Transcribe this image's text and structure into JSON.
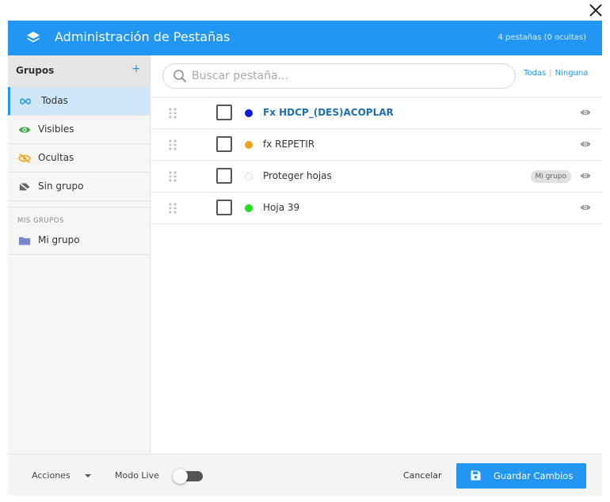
{
  "header": {
    "title": "Administración de Pestañas",
    "count": "4 pestañas (0 ocultas)"
  },
  "sidebar": {
    "heading": "Grupos",
    "add_label": "+",
    "items": [
      {
        "label": "Todas",
        "icon": "infinity-icon",
        "active": true
      },
      {
        "label": "Visibles",
        "icon": "eye-icon"
      },
      {
        "label": "Ocultas",
        "icon": "eye-off-icon"
      },
      {
        "label": "Sin grupo",
        "icon": "no-tag-icon"
      }
    ],
    "section_title": "MIS GRUPOS",
    "groups": [
      {
        "label": "Mi grupo",
        "icon": "folder-icon"
      }
    ]
  },
  "search": {
    "placeholder": "Buscar pestaña...",
    "value": ""
  },
  "filters": {
    "all_label": "Todas",
    "none_label": "Ninguna"
  },
  "tabs": [
    {
      "name": "Fx HDCP_(DES)ACOPLAR",
      "color": "#0b1bdc",
      "active": true,
      "group": ""
    },
    {
      "name": "fx REPETIR",
      "color": "#f0a020",
      "active": false,
      "group": ""
    },
    {
      "name": "Proteger hojas",
      "color": "#ffffff",
      "active": false,
      "group": "Mi grupo"
    },
    {
      "name": "Hoja 39",
      "color": "#22e01e",
      "active": false,
      "group": ""
    }
  ],
  "footer": {
    "actions_label": "Acciones",
    "live_label": "Modo Live",
    "live_on": false,
    "cancel_label": "Cancelar",
    "save_label": "Guardar Cambios"
  },
  "colors": {
    "accent": "#2196f3"
  }
}
